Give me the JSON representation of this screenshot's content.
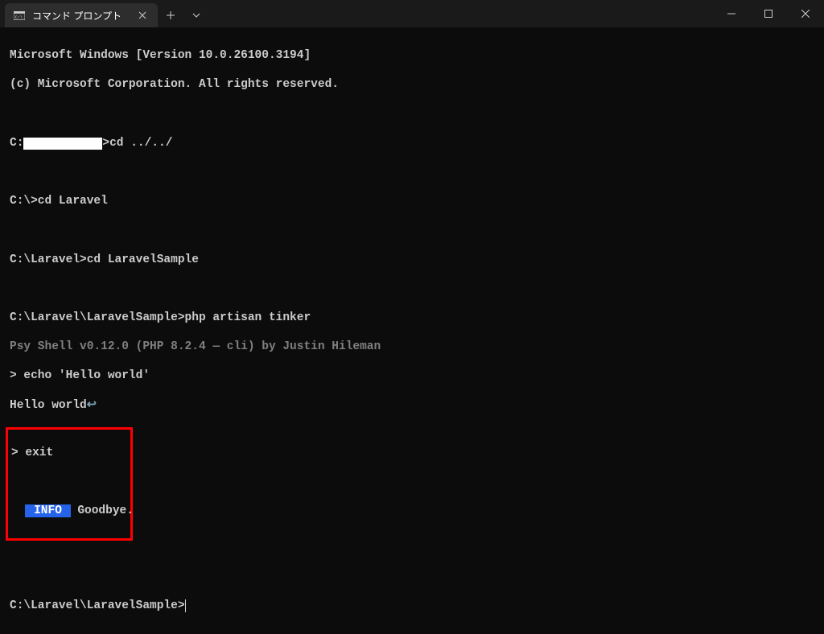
{
  "titlebar": {
    "tab_title": "コマンド プロンプト"
  },
  "terminal": {
    "line1": "Microsoft Windows [Version 10.0.26100.3194]",
    "line2": "(c) Microsoft Corporation. All rights reserved.",
    "prompt1_pre": "C:",
    "prompt1_post": ">cd ../../",
    "prompt2": "C:\\>cd Laravel",
    "prompt3": "C:\\Laravel>cd LaravelSample",
    "prompt4": "C:\\Laravel\\LaravelSample>php artisan tinker",
    "psy_shell": "Psy Shell v0.12.0 (PHP 8.2.4 — cli) by Justin Hileman",
    "echo_cmd": "> echo 'Hello world'",
    "echo_output_pre": "Hello world",
    "exit_cmd": "> exit",
    "info_badge": " INFO ",
    "goodbye": " Goodbye.",
    "prompt5": "C:\\Laravel\\LaravelSample>"
  }
}
